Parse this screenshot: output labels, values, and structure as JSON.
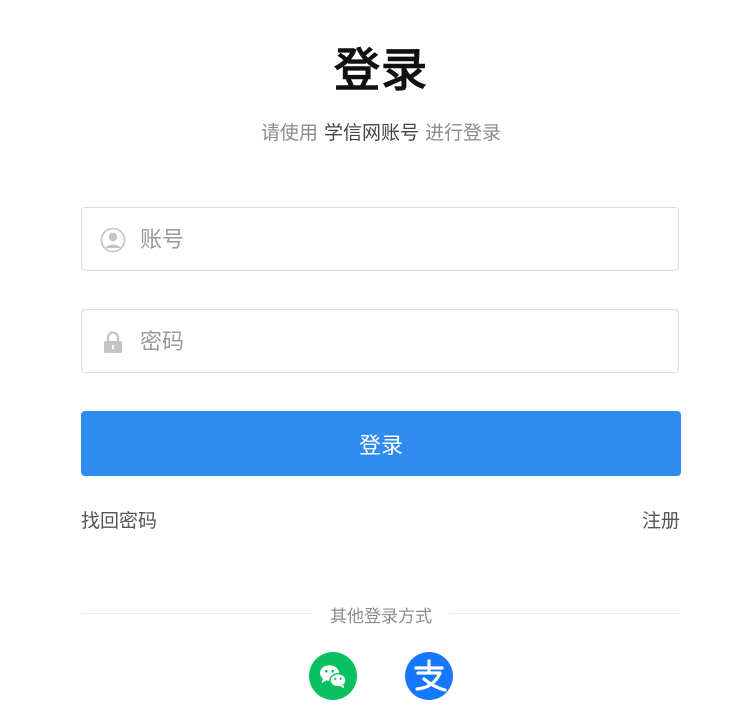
{
  "header": {
    "title": "登录",
    "subtitle_prefix": "请使用",
    "subtitle_account": "学信网账号",
    "subtitle_suffix": "进行登录"
  },
  "form": {
    "account_placeholder": "账号",
    "account_value": "",
    "password_placeholder": "密码",
    "password_value": "",
    "submit_label": "登录"
  },
  "links": {
    "forgot_password": "找回密码",
    "register": "注册"
  },
  "other_login": {
    "label": "其他登录方式",
    "methods": [
      {
        "name": "wechat",
        "icon": "wechat-icon",
        "color": "#07c160"
      },
      {
        "name": "alipay",
        "icon": "alipay-icon",
        "color": "#1677ff"
      }
    ]
  },
  "colors": {
    "primary": "#2d8cee",
    "wechat": "#07c160",
    "alipay": "#1677ff"
  }
}
